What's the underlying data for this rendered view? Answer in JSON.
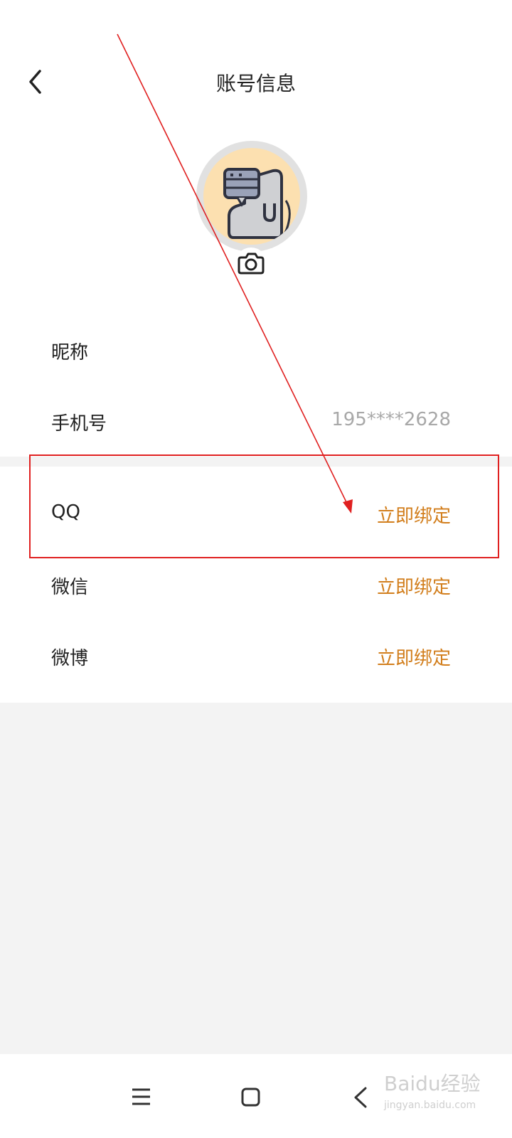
{
  "header": {
    "title": "账号信息",
    "back_icon": "chevron-left-icon"
  },
  "avatar": {
    "camera_icon": "camera-icon",
    "colors": {
      "ring": "#e1e1e1",
      "fill": "#fce0b0"
    }
  },
  "rows": [
    {
      "label": "昵称",
      "value": ""
    },
    {
      "label": "手机号",
      "value": "195****2628"
    },
    {
      "label": "QQ",
      "action": "立即绑定"
    },
    {
      "label": "微信",
      "action": "立即绑定"
    },
    {
      "label": "微博",
      "action": "立即绑定"
    }
  ],
  "navbar": {
    "menu_icon": "menu-icon",
    "home_icon": "home-square-icon",
    "back_icon": "back-chevron-icon"
  },
  "watermark": {
    "brand": "Baidu经验",
    "site": "jingyan.baidu.com"
  },
  "colors": {
    "accent": "#d27e1c",
    "annotation": "#e02020",
    "muted": "#a8a8a8",
    "background_gray": "#f3f3f3"
  }
}
